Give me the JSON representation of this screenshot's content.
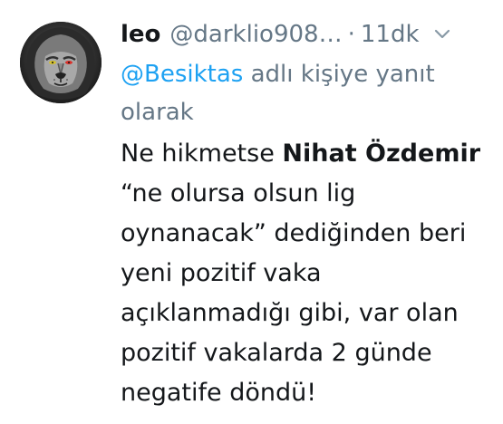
{
  "tweet": {
    "author_name": "leo",
    "handle": "@darklio908…",
    "separator": "·",
    "time": "11dk",
    "menu_icon": "chevron-down-icon",
    "reply": {
      "mention": "@Besiktas",
      "suffix": " adlı kişiye yanıt olarak"
    },
    "text": {
      "part1": "Ne hikmetse ",
      "bold": "Nihat Özdemir",
      "part2": " “ne olursa olsun lig oynanacak” dediğinden beri yeni pozitif vaka açıklanmadığı gibi, var olan pozitif vakalarda  2 günde negatife döndü!"
    },
    "colors": {
      "link": "#1da1f2",
      "secondary": "#657786",
      "text": "#14171a"
    }
  }
}
